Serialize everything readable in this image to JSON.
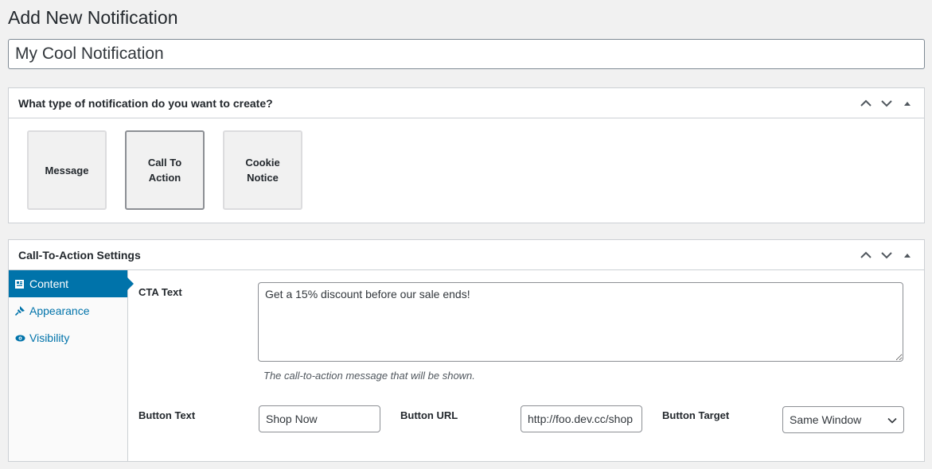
{
  "page": {
    "title": "Add New Notification",
    "post_title_value": "My Cool Notification"
  },
  "type_box": {
    "heading": "What type of notification do you want to create?",
    "types": [
      {
        "label": "Message",
        "selected": false
      },
      {
        "label": "Call To Action",
        "selected": true
      },
      {
        "label": "Cookie Notice",
        "selected": false
      }
    ]
  },
  "settings_box": {
    "heading": "Call-To-Action Settings",
    "tabs": [
      {
        "label": "Content",
        "icon": "content-icon",
        "active": true
      },
      {
        "label": "Appearance",
        "icon": "pin-icon",
        "active": false
      },
      {
        "label": "Visibility",
        "icon": "eye-icon",
        "active": false
      }
    ],
    "cta_text": {
      "label": "CTA Text",
      "value": "Get a 15% discount before our sale ends!",
      "help": "The call-to-action message that will be shown."
    },
    "button_text": {
      "label": "Button Text",
      "value": "Shop Now"
    },
    "button_url": {
      "label": "Button URL",
      "value": "http://foo.dev.cc/shop"
    },
    "button_target": {
      "label": "Button Target",
      "value": "Same Window"
    }
  },
  "colors": {
    "accent": "#0073aa",
    "border": "#ccd0d4",
    "background": "#f1f1f1"
  }
}
